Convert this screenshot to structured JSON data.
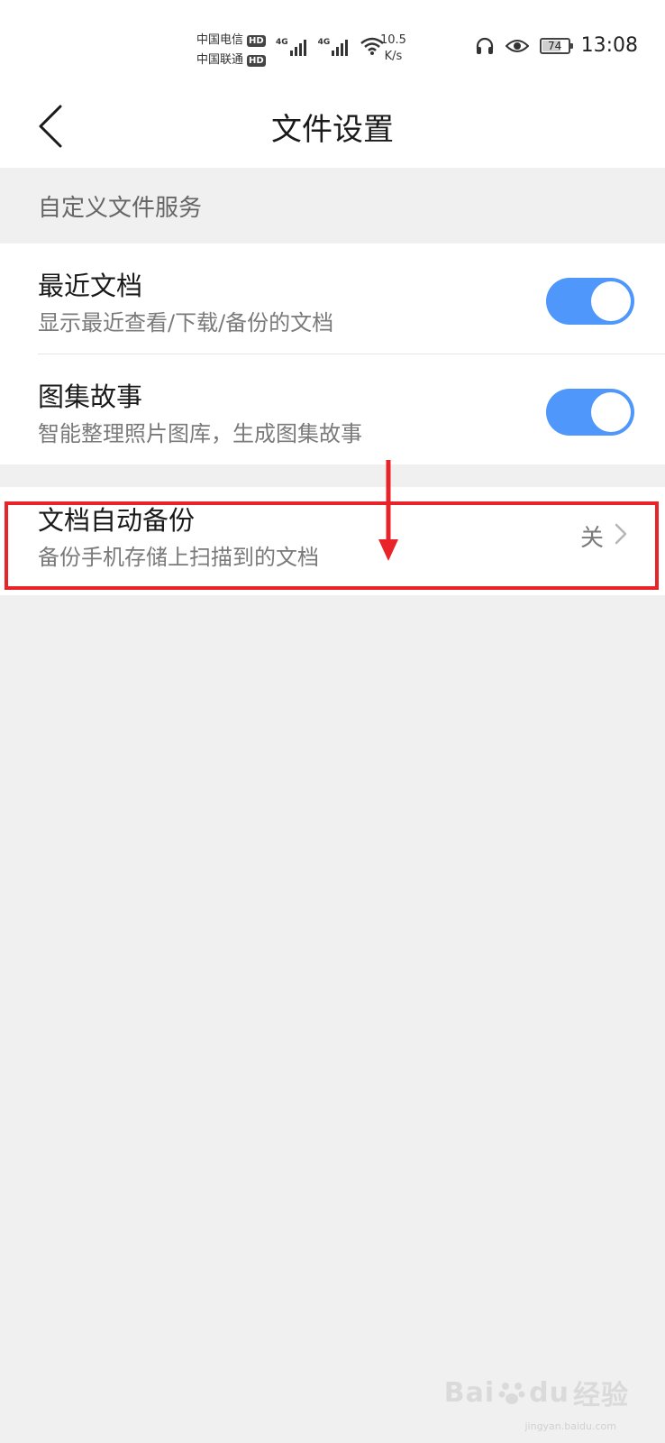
{
  "status_bar": {
    "carrier_1": "中国电信",
    "carrier_2": "中国联通",
    "hd_badge": "HD",
    "network_1": "4G",
    "network_2": "4G",
    "speed_value": "10.5",
    "speed_unit": "K/s",
    "battery_level": "74",
    "battery_fraction": 0.74,
    "time": "13:08"
  },
  "header": {
    "title": "文件设置"
  },
  "section": {
    "label": "自定义文件服务"
  },
  "settings": {
    "recent_docs": {
      "title": "最近文档",
      "subtitle": "显示最近查看/下载/备份的文档",
      "enabled": true
    },
    "gallery_story": {
      "title": "图集故事",
      "subtitle": "智能整理照片图库，生成图集故事",
      "enabled": true
    },
    "auto_backup": {
      "title": "文档自动备份",
      "subtitle": "备份手机存储上扫描到的文档",
      "value": "关"
    }
  },
  "colors": {
    "toggle_on": "#4f97fb",
    "annotation": "#e8232a",
    "background": "#f0f0f0"
  },
  "watermark": {
    "brand": "Bai",
    "brand_2": "du",
    "label": "经验",
    "url": "jingyan.baidu.com"
  }
}
